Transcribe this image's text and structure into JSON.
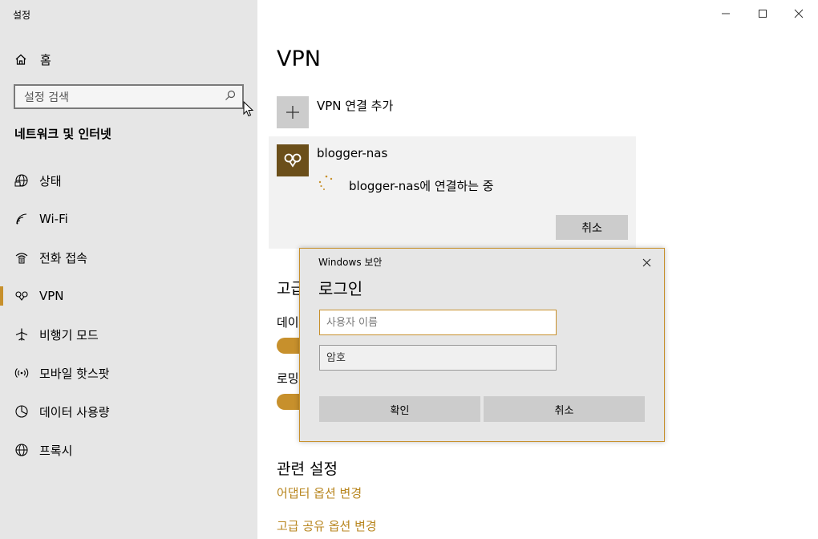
{
  "window": {
    "title": "설정",
    "minimize": "minimize-icon",
    "maximize": "maximize-icon",
    "close": "close-icon"
  },
  "sidebar": {
    "home_label": "홈",
    "search_placeholder": "설정 검색",
    "section_title": "네트워크 및 인터넷",
    "items": [
      {
        "label": "상태",
        "icon": "globe-network-icon"
      },
      {
        "label": "Wi-Fi",
        "icon": "wifi-icon"
      },
      {
        "label": "전화 접속",
        "icon": "dialup-icon"
      },
      {
        "label": "VPN",
        "icon": "vpn-icon",
        "selected": true
      },
      {
        "label": "비행기 모드",
        "icon": "airplane-icon"
      },
      {
        "label": "모바일 핫스팟",
        "icon": "hotspot-icon"
      },
      {
        "label": "데이터 사용량",
        "icon": "data-usage-icon"
      },
      {
        "label": "프록시",
        "icon": "globe-icon"
      }
    ]
  },
  "main": {
    "title": "VPN",
    "add_vpn_label": "VPN 연결 추가",
    "connection": {
      "name": "blogger-nas",
      "status": "blogger-nas에 연결하는 중",
      "cancel_label": "취소"
    },
    "advanced_heading": "고급",
    "row1_label": "데이",
    "row2_label": "로밍",
    "related_heading": "관련 설정",
    "links": [
      "어댑터 옵션 변경",
      "고급 공유 옵션 변경"
    ]
  },
  "dialog": {
    "title": "Windows 보안",
    "heading": "로그인",
    "username_placeholder": "사용자 이름",
    "password_placeholder": "암호",
    "ok_label": "확인",
    "cancel_label": "취소"
  },
  "colors": {
    "accent": "#c7902c",
    "sidebar_bg": "#e6e6e6",
    "vpn_logo_bg": "#6b4f1a"
  }
}
